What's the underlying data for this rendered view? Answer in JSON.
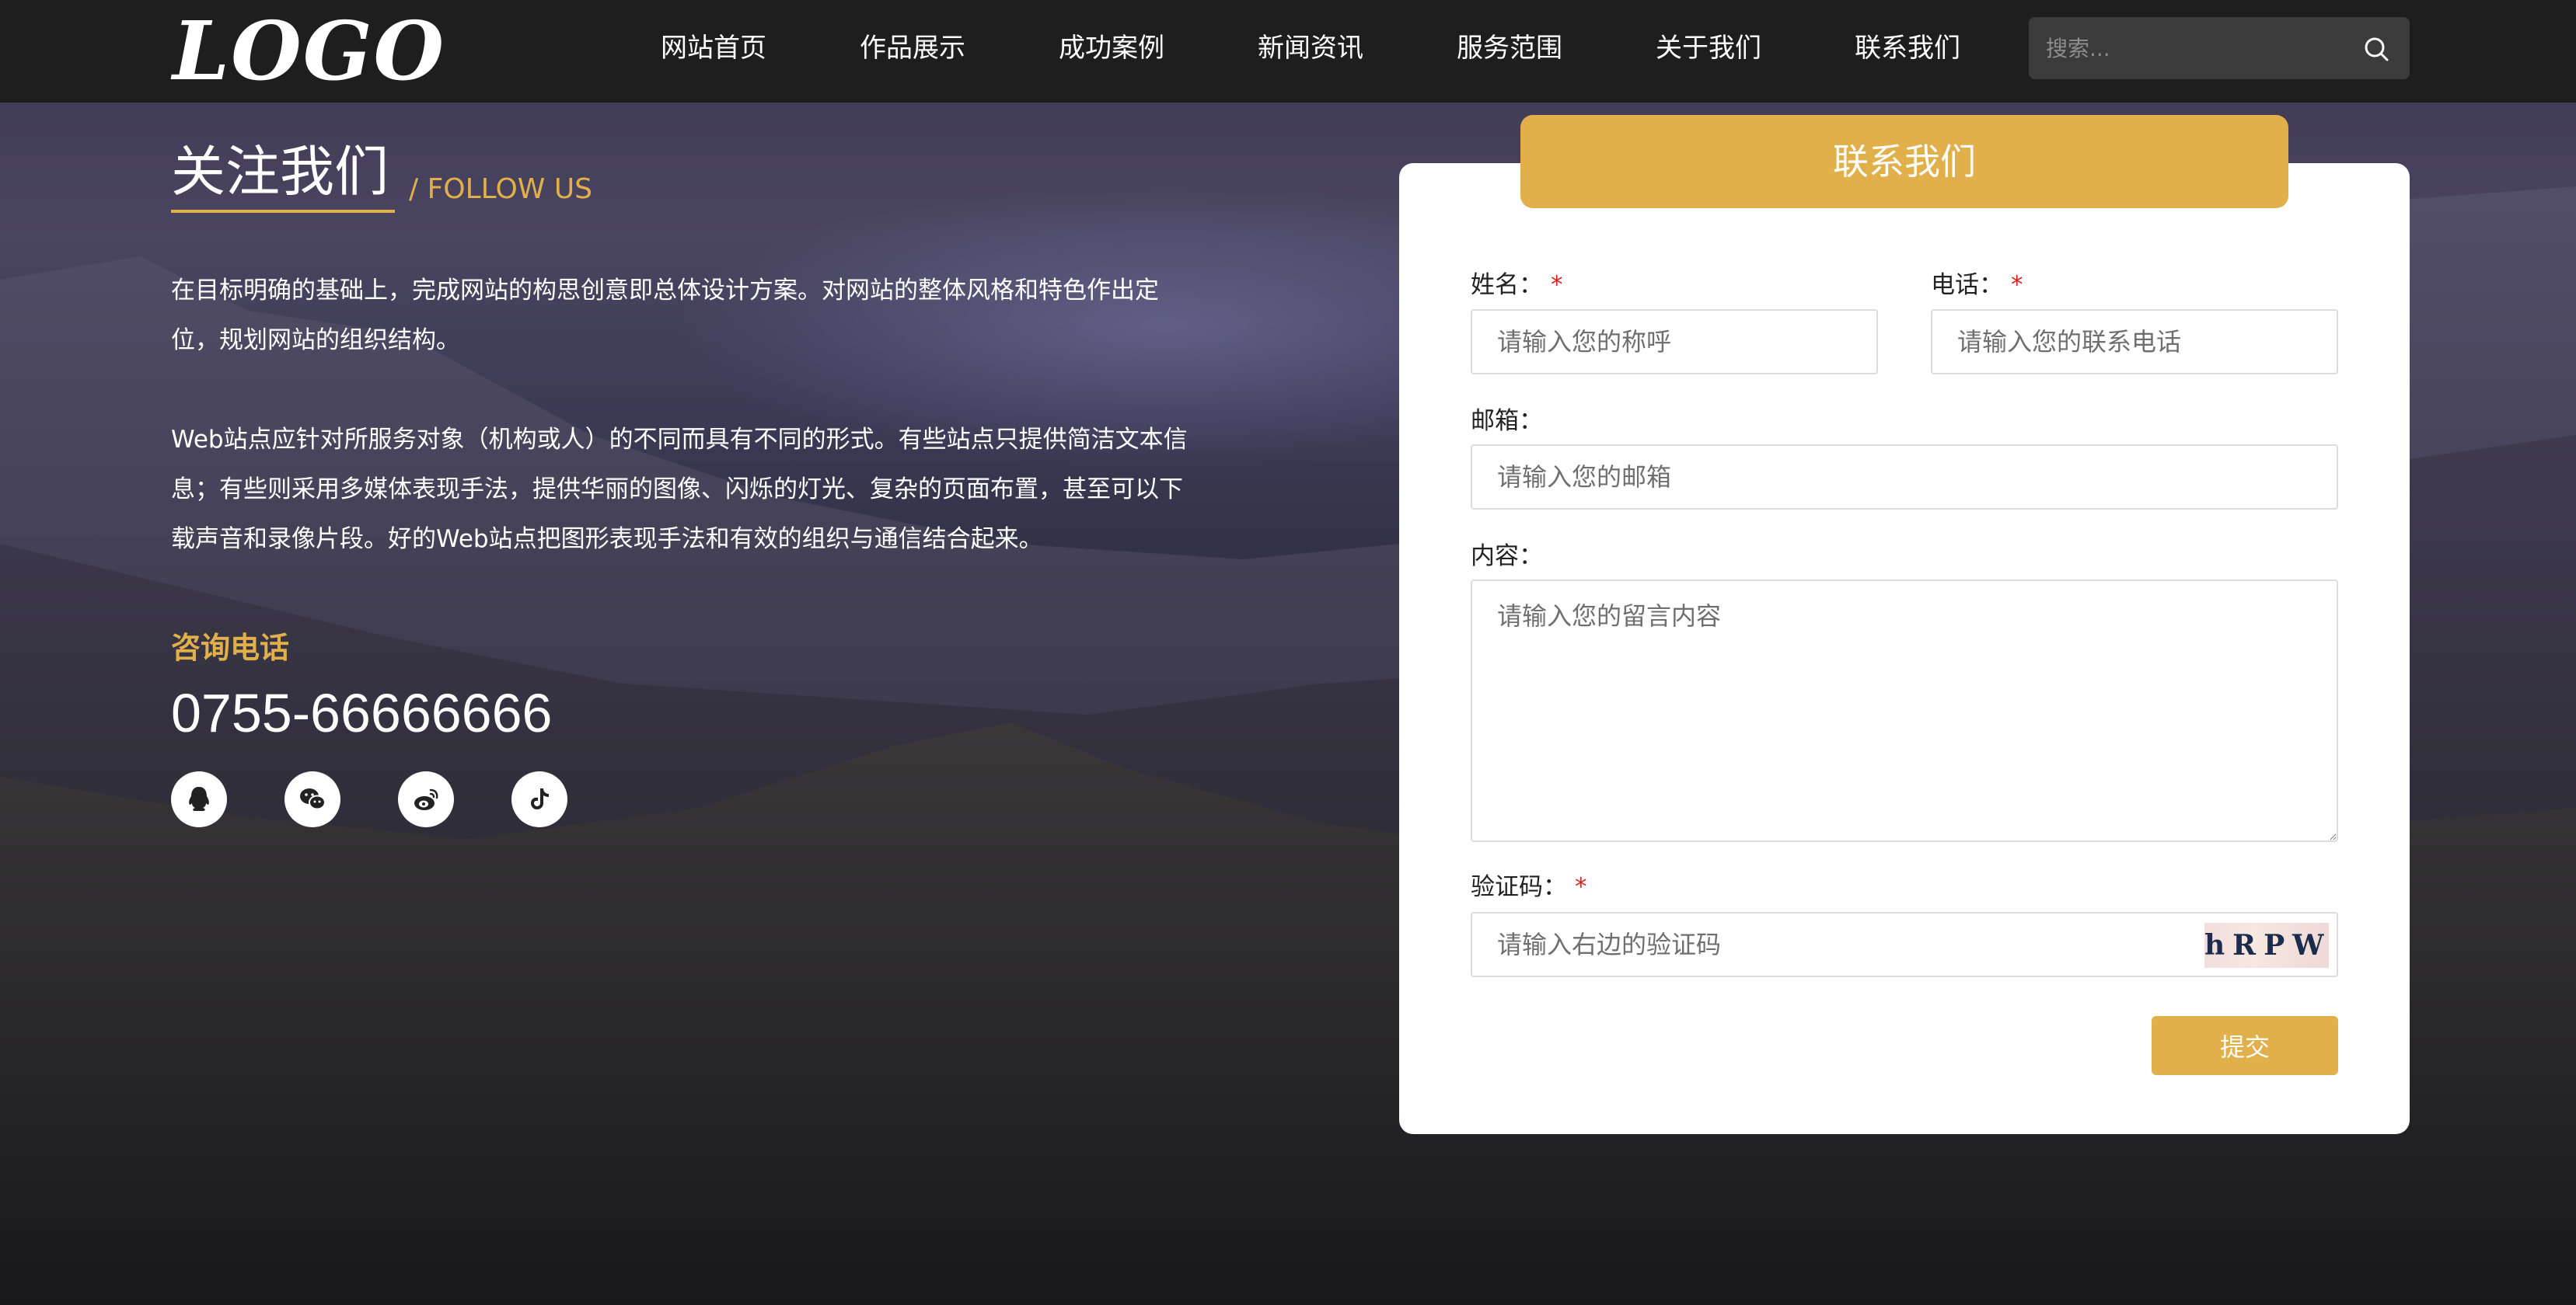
{
  "header": {
    "logo_text": "LOGO",
    "nav": [
      {
        "label": "网站首页"
      },
      {
        "label": "作品展示"
      },
      {
        "label": "成功案例"
      },
      {
        "label": "新闻资讯"
      },
      {
        "label": "服务范围"
      },
      {
        "label": "关于我们"
      },
      {
        "label": "联系我们"
      }
    ],
    "search": {
      "placeholder": "搜索...",
      "icon": "search-icon"
    }
  },
  "follow": {
    "title": "关注我们",
    "subtitle": "/ FOLLOW US",
    "paragraph1": "在目标明确的基础上，完成网站的构思创意即总体设计方案。对网站的整体风格和特色作出定位，规划网站的组织结构。",
    "paragraph2": "Web站点应针对所服务对象（机构或人）的不同而具有不同的形式。有些站点只提供简洁文本信息；有些则采用多媒体表现手法，提供华丽的图像、闪烁的灯光、复杂的页面布置，甚至可以下载声音和录像片段。好的Web站点把图形表现手法和有效的组织与通信结合起来。",
    "phone_label": "咨询电话",
    "phone_number": "0755-66666666",
    "socials": [
      "qq-icon",
      "wechat-icon",
      "weibo-icon",
      "tiktok-icon"
    ]
  },
  "form": {
    "title": "联系我们",
    "name": {
      "label": "姓名：",
      "required_mark": "*",
      "placeholder": "请输入您的称呼"
    },
    "phone": {
      "label": "电话：",
      "required_mark": "*",
      "placeholder": "请输入您的联系电话"
    },
    "email": {
      "label": "邮箱：",
      "placeholder": "请输入您的邮箱"
    },
    "content": {
      "label": "内容：",
      "placeholder": "请输入您的留言内容"
    },
    "captcha": {
      "label": "验证码：",
      "required_mark": "*",
      "placeholder": "请输入右边的验证码",
      "image_text": "hRPW"
    },
    "submit_label": "提交"
  },
  "colors": {
    "accent": "#e1b04a",
    "header_bg": "#1e1e1e",
    "required": "#e02020"
  }
}
